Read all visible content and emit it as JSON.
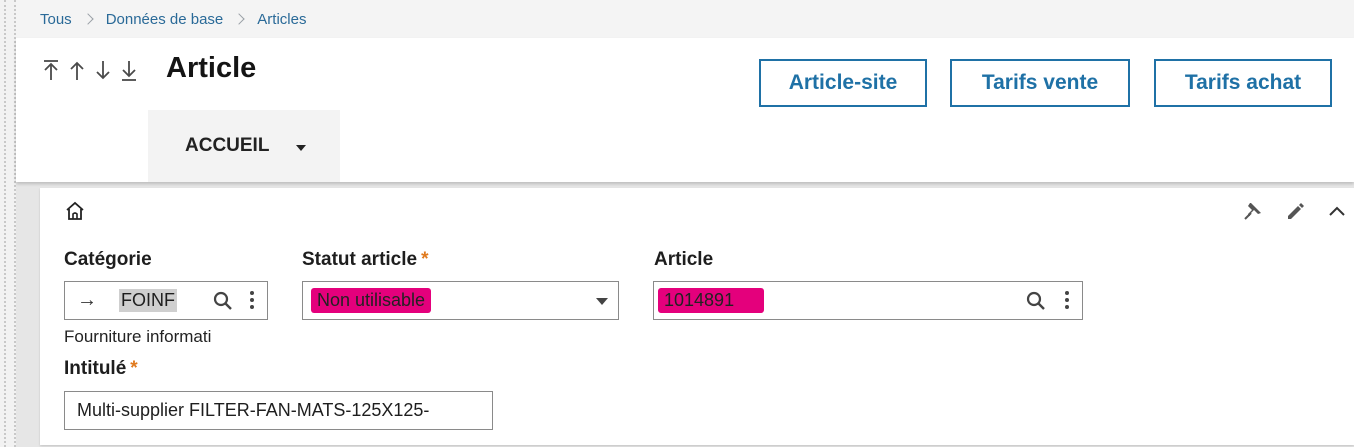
{
  "breadcrumb": {
    "items": [
      "Tous",
      "Données de base",
      "Articles"
    ]
  },
  "header": {
    "title": "Article",
    "nav_icons": [
      "first-record-icon",
      "previous-record-icon",
      "next-record-icon",
      "last-record-icon"
    ],
    "buttons": {
      "article_site": "Article-site",
      "tarifs_vente": "Tarifs vente",
      "tarifs_achat": "Tarifs achat"
    },
    "tab": "ACCUEIL"
  },
  "section": {
    "icons": [
      "home-icon",
      "pin-icon",
      "edit-icon",
      "collapse-icon"
    ]
  },
  "fields": {
    "categorie": {
      "label": "Catégorie",
      "value": "FOINF",
      "description": "Fourniture informati"
    },
    "statut": {
      "label": "Statut article",
      "required_mark": "*",
      "value": "Non utilisable"
    },
    "article": {
      "label": "Article",
      "value": "1014891"
    },
    "intitule": {
      "label": "Intitulé",
      "required_mark": "*",
      "value": "Multi-supplier FILTER-FAN-MATS-125X125-"
    }
  },
  "colors": {
    "accent": "#1f71a6",
    "required": "#e07a1e",
    "highlight": "#e4007c"
  }
}
